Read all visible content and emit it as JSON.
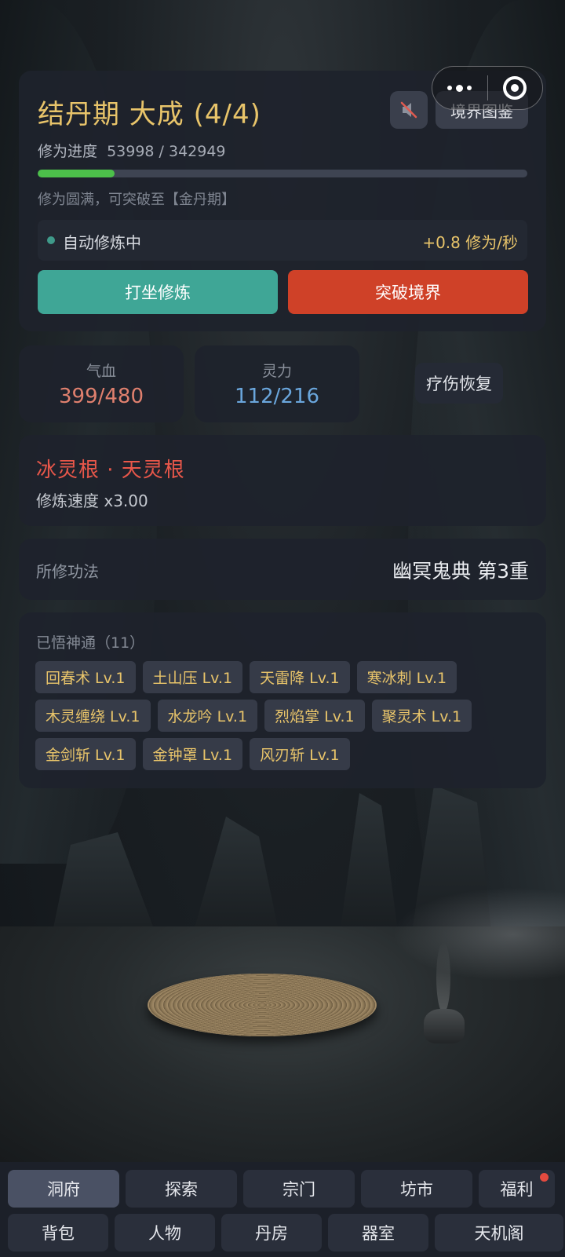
{
  "realm": {
    "title": "结丹期 大成 (4/4)",
    "atlas_button": "境界图鉴",
    "progress_label": "修为进度",
    "progress_value": "53998 / 342949",
    "progress_fraction": 0.1575,
    "hint": "修为圆满，可突破至【金丹期】",
    "auto_status": "自动修炼中",
    "auto_rate": "+0.8 修为/秒",
    "meditate_button": "打坐修炼",
    "breakthrough_button": "突破境界"
  },
  "stats": {
    "hp_label": "气血",
    "hp_value": "399/480",
    "mp_label": "灵力",
    "mp_value": "112/216",
    "heal_button": "疗伤恢复"
  },
  "root": {
    "title": "冰灵根 · 天灵根",
    "speed": "修炼速度 x3.00"
  },
  "technique": {
    "label": "所修功法",
    "value": "幽冥鬼典 第3重"
  },
  "skills": {
    "title": "已悟神通（11）",
    "items": [
      "回春术 Lv.1",
      "土山压 Lv.1",
      "天雷降 Lv.1",
      "寒冰刺 Lv.1",
      "木灵缠绕 Lv.1",
      "水龙吟 Lv.1",
      "烈焰掌 Lv.1",
      "聚灵术 Lv.1",
      "金剑斩 Lv.1",
      "金钟罩 Lv.1",
      "风刃斩 Lv.1"
    ]
  },
  "nav": {
    "row1": [
      "洞府",
      "探索",
      "宗门",
      "坊市",
      "福利"
    ],
    "row2": [
      "背包",
      "人物",
      "丹房",
      "器室",
      "天机阁"
    ]
  },
  "icons": {
    "mute": "speaker-muted-icon",
    "capsule_more": "more-dots-icon",
    "capsule_close": "target-close-icon"
  },
  "colors": {
    "gold": "#e8c46a",
    "progress": "#4cc04a",
    "meditate": "#3fa696",
    "breakthrough": "#cf4128",
    "hp": "#e0806e",
    "mp": "#6aa6dc",
    "root": "#e8574a"
  }
}
